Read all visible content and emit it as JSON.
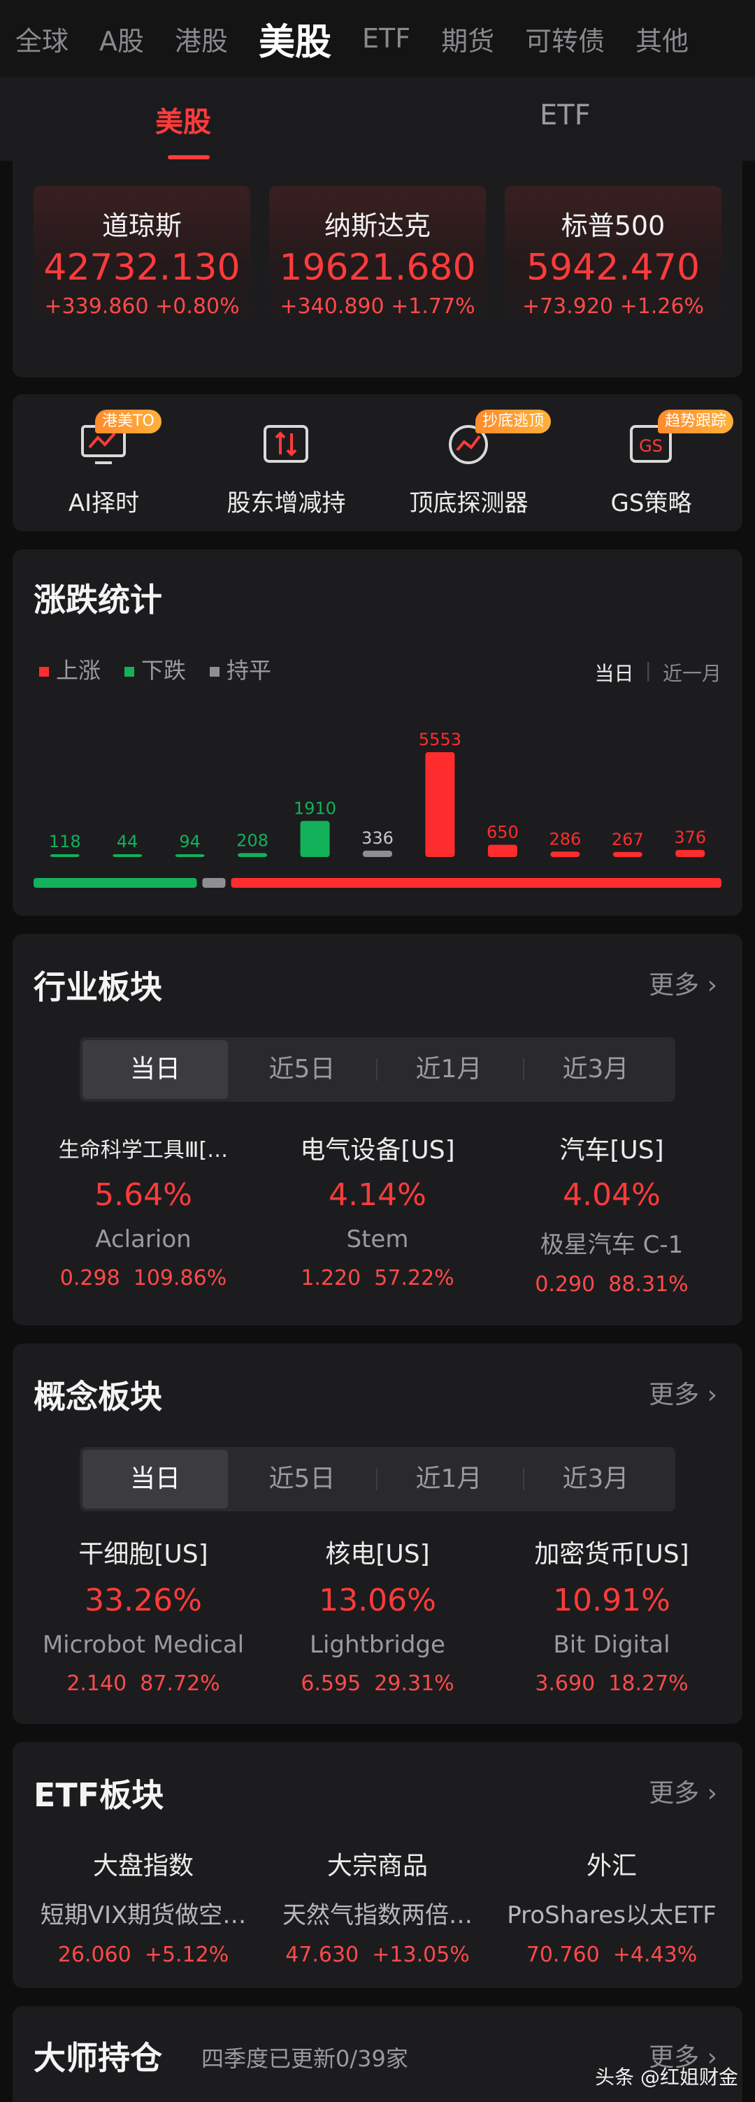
{
  "top_tabs": [
    "全球",
    "A股",
    "港股",
    "美股",
    "ETF",
    "期货",
    "可转债",
    "其他"
  ],
  "top_tab_active": "美股",
  "sub_tabs": [
    "美股",
    "ETF"
  ],
  "indices": [
    {
      "name": "道琼斯",
      "value": "42732.130",
      "change": "+339.860",
      "pct": "+0.80%"
    },
    {
      "name": "纳斯达克",
      "value": "19621.680",
      "change": "+340.890",
      "pct": "+1.77%"
    },
    {
      "name": "标普500",
      "value": "5942.470",
      "change": "+73.920",
      "pct": "+1.26%"
    }
  ],
  "tools": [
    {
      "label": "AI择时",
      "badge": "港美TO",
      "icon": "chart-monitor-icon"
    },
    {
      "label": "股东增减持",
      "badge": "",
      "icon": "arrows-updown-icon"
    },
    {
      "label": "顶底探测器",
      "badge": "抄底逃顶",
      "icon": "radar-icon"
    },
    {
      "label": "GS策略",
      "badge": "趋势跟踪",
      "icon": "gs-icon"
    }
  ],
  "stats": {
    "title": "涨跌统计",
    "legend": {
      "up": "上涨",
      "down": "下跌",
      "flat": "持平"
    },
    "period_on": "当日",
    "period_off": "近一月",
    "colors": {
      "up": "#ff2d2d",
      "down": "#13b15a",
      "flat": "#8e8e93"
    }
  },
  "chart_data": {
    "type": "bar",
    "values": [
      118,
      44,
      94,
      208,
      1910,
      336,
      5553,
      650,
      286,
      267,
      376
    ],
    "colors": [
      "down",
      "down",
      "down",
      "down",
      "down",
      "flat",
      "up",
      "up",
      "up",
      "up",
      "up"
    ],
    "labels": [
      "118",
      "44",
      "94",
      "208",
      "1910",
      "336",
      "5553",
      "650",
      "286",
      "267",
      "376"
    ],
    "breadth": {
      "down": 2374,
      "flat": 336,
      "up": 7132
    }
  },
  "industry": {
    "title": "行业板块",
    "more": "更多",
    "segments": [
      "当日",
      "近5日",
      "近1月",
      "近3月"
    ],
    "items": [
      {
        "name": "生命科学工具Ⅲ[…",
        "pct": "5.64%",
        "stock": "Aclarion",
        "price": "0.298",
        "stock_pct": "109.86%"
      },
      {
        "name": "电气设备[US]",
        "pct": "4.14%",
        "stock": "Stem",
        "price": "1.220",
        "stock_pct": "57.22%"
      },
      {
        "name": "汽车[US]",
        "pct": "4.04%",
        "stock": "极星汽车 C-1",
        "price": "0.290",
        "stock_pct": "88.31%"
      }
    ]
  },
  "concept": {
    "title": "概念板块",
    "more": "更多",
    "segments": [
      "当日",
      "近5日",
      "近1月",
      "近3月"
    ],
    "items": [
      {
        "name": "干细胞[US]",
        "pct": "33.26%",
        "stock": "Microbot Medical",
        "price": "2.140",
        "stock_pct": "87.72%"
      },
      {
        "name": "核电[US]",
        "pct": "13.06%",
        "stock": "Lightbridge",
        "price": "6.595",
        "stock_pct": "29.31%"
      },
      {
        "name": "加密货币[US]",
        "pct": "10.91%",
        "stock": "Bit Digital",
        "price": "3.690",
        "stock_pct": "18.27%"
      }
    ]
  },
  "etf": {
    "title": "ETF板块",
    "more": "更多",
    "items": [
      {
        "name": "大盘指数",
        "fund": "短期VIX期货做空…",
        "price": "26.060",
        "pct": "+5.12%"
      },
      {
        "name": "大宗商品",
        "fund": "天然气指数两倍…",
        "price": "47.630",
        "pct": "+13.05%"
      },
      {
        "name": "外汇",
        "fund": "ProShares以太ETF",
        "price": "70.760",
        "pct": "+4.43%"
      }
    ]
  },
  "masters": {
    "title": "大师持仓",
    "subtitle": "四季度已更新0/39家",
    "more": "更多"
  },
  "watermark": "头条 @红姐财金"
}
